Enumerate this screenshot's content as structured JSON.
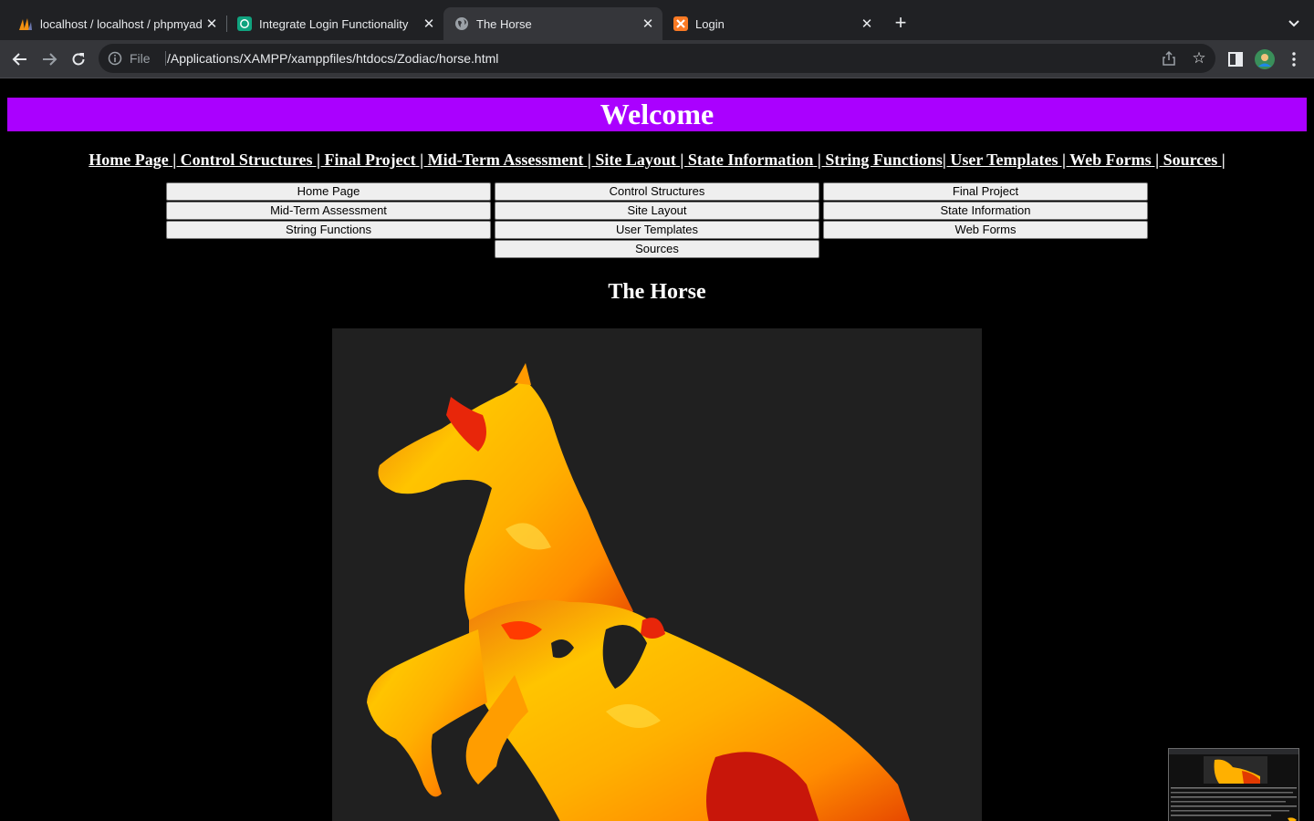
{
  "browser": {
    "tabs": [
      {
        "title": "localhost / localhost / phpmyadmin",
        "favicon": "phpmyadmin-icon",
        "active": false
      },
      {
        "title": "Integrate Login Functionality",
        "favicon": "chatgpt-icon",
        "active": false
      },
      {
        "title": "The Horse",
        "favicon": "globe-icon",
        "active": true
      },
      {
        "title": "Login",
        "favicon": "xampp-icon",
        "active": false
      }
    ],
    "address": {
      "scheme_label": "File",
      "url": "/Applications/XAMPP/xamppfiles/htdocs/Zodiac/horse.html"
    }
  },
  "page": {
    "banner": "Welcome",
    "text_nav": [
      "Home Page",
      " | ",
      "Control Structures",
      " | ",
      "Final Project",
      " | ",
      "Mid-Term Assessment",
      " | ",
      "Site Layout",
      " | ",
      "State Information",
      " | ",
      "String Functions",
      "| ",
      "User Templates",
      " | ",
      "Web Forms",
      " | ",
      "Sources",
      " |"
    ],
    "buttons": [
      [
        "Home Page",
        "Control Structures",
        "Final Project"
      ],
      [
        "Mid-Term Assessment",
        "Site Layout",
        "State Information"
      ],
      [
        "String Functions",
        "User Templates",
        "Web Forms"
      ],
      [
        "Sources"
      ]
    ],
    "heading": "The Horse",
    "image": "fiery-horse-illustration"
  },
  "colors": {
    "banner_bg": "#aa00ff",
    "page_bg": "#000000",
    "tabbar_bg": "#202124",
    "toolbar_bg": "#35363a"
  }
}
